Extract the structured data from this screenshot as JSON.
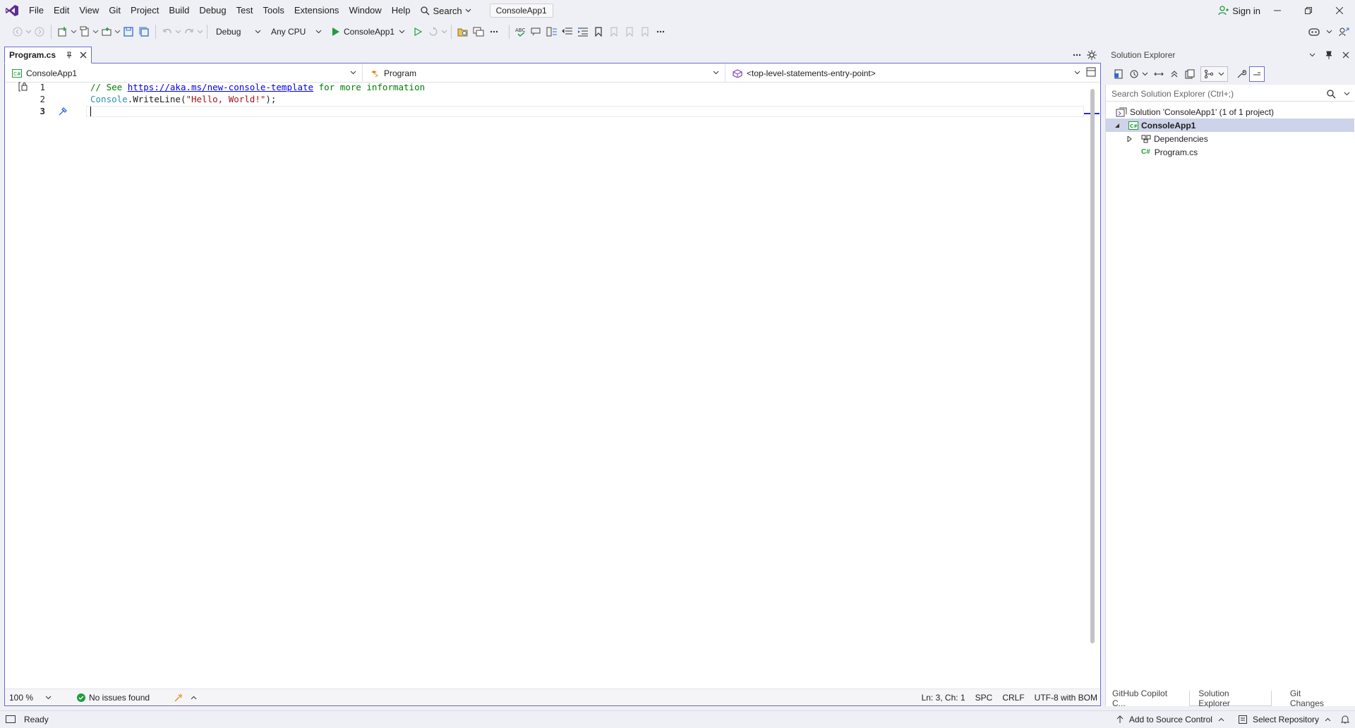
{
  "menu": {
    "items": [
      "File",
      "Edit",
      "View",
      "Git",
      "Project",
      "Build",
      "Debug",
      "Test",
      "Tools",
      "Extensions",
      "Window",
      "Help"
    ],
    "search_label": "Search",
    "solution_chip": "ConsoleApp1",
    "sign_in": "Sign in"
  },
  "toolbar": {
    "configuration": "Debug",
    "platform": "Any CPU",
    "start_target": "ConsoleApp1"
  },
  "editor": {
    "tab_label": "Program.cs",
    "nav_project": "ConsoleApp1",
    "nav_type": "Program",
    "nav_member": "<top-level-statements-entry-point>",
    "lines": [
      {
        "num": "1",
        "comment_prefix": "// See ",
        "link": "https://aka.ms/new-console-template",
        "comment_suffix": " for more information"
      },
      {
        "num": "2",
        "class": "Console",
        "method": ".WriteLine(",
        "string": "\"Hello, World!\"",
        "end": ");"
      },
      {
        "num": "3"
      }
    ]
  },
  "editor_status": {
    "zoom": "100 %",
    "issues": "No issues found",
    "position": "Ln: 3, Ch: 1",
    "whitespace": "SPC",
    "line_endings": "CRLF",
    "encoding": "UTF-8 with BOM"
  },
  "solution_explorer": {
    "title": "Solution Explorer",
    "search_placeholder": "Search Solution Explorer (Ctrl+;)",
    "tree": {
      "solution": "Solution 'ConsoleApp1' (1 of 1 project)",
      "project": "ConsoleApp1",
      "dependencies": "Dependencies",
      "file": "Program.cs",
      "file_badge": "C#"
    },
    "bottom_tabs": [
      "GitHub Copilot C...",
      "Solution Explorer",
      "Git Changes"
    ]
  },
  "statusbar": {
    "ready": "Ready",
    "add_source_control": "Add to Source Control",
    "select_repository": "Select Repository"
  },
  "colors": {
    "accent": "#6b6bd0",
    "vs_purple": "#68217a",
    "run_green": "#1e9e3a",
    "comment_green": "#008000",
    "string_red": "#a31515",
    "type_teal": "#2b91af"
  }
}
